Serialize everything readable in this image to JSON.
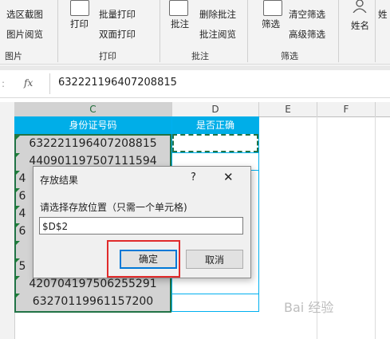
{
  "ribbon": {
    "col1": {
      "item1": "选区截图",
      "item2": "图片阅览",
      "group": "图片"
    },
    "print": {
      "big": "打印",
      "item1": "批量打印",
      "item2": "双面打印",
      "group": "打印"
    },
    "comment": {
      "big": "批注",
      "item1": "删除批注",
      "item2": "批注阅览",
      "group": "批注"
    },
    "filter": {
      "big": "筛选",
      "item1": "清空筛选",
      "item2": "高级筛选",
      "group": "筛选"
    },
    "name": {
      "big": "姓名",
      "partial": "姓 生"
    }
  },
  "formula_bar": {
    "fx": "fx",
    "value": "632221196407208815"
  },
  "columns": [
    "C",
    "D",
    "E",
    "F"
  ],
  "headers": {
    "c": "身份证号码",
    "d": "是否正确"
  },
  "rows": [
    {
      "c": "632221196407208815"
    },
    {
      "c": "440901197507111594"
    },
    {
      "c": "4"
    },
    {
      "c": "6"
    },
    {
      "c": "4"
    },
    {
      "c": "6"
    },
    {
      "c": "5"
    },
    {
      "c": "420704197506255291"
    },
    {
      "c": "63270119961157200"
    }
  ],
  "dialog": {
    "title": "存放结果",
    "help": "?",
    "close": "✕",
    "label": "请选择存放位置（只需一个单元格)",
    "value": "$D$2",
    "ok": "确定",
    "cancel": "取消"
  },
  "watermark": "Bai 经验"
}
